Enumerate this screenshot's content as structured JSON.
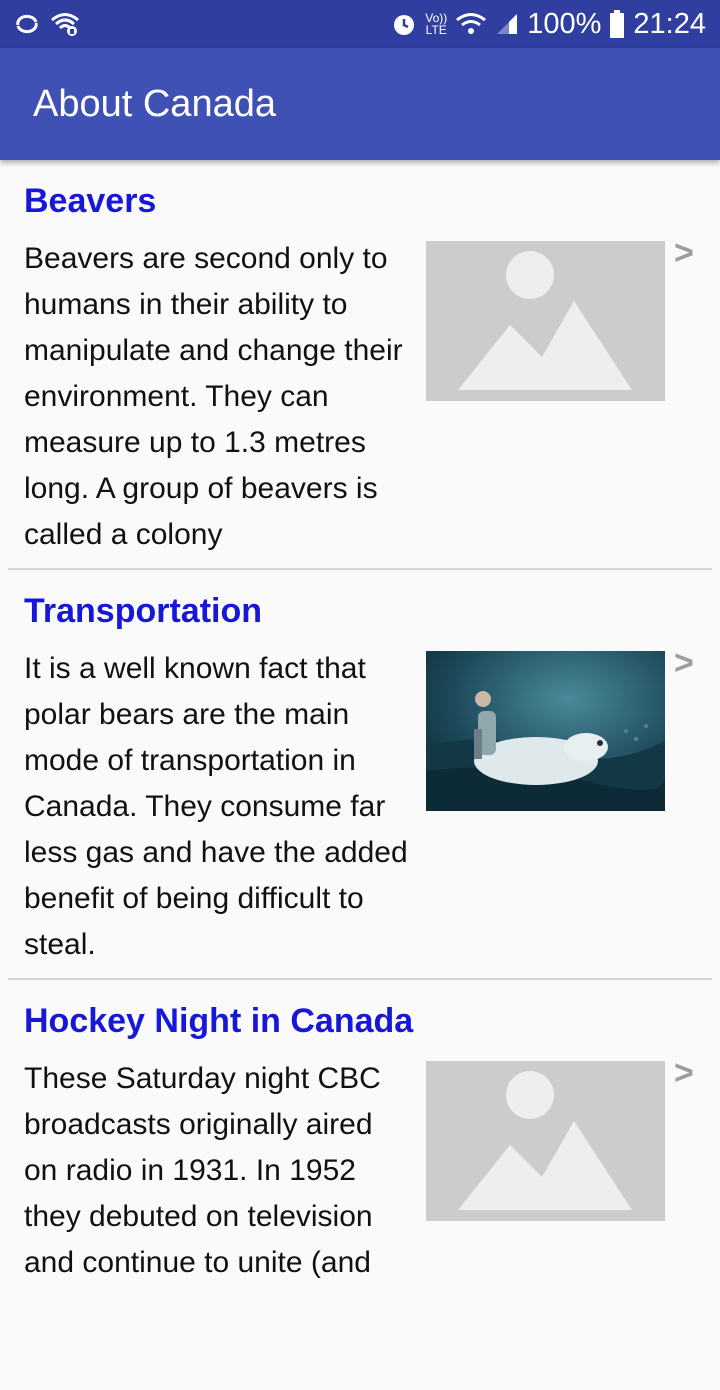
{
  "status_bar": {
    "battery": "100%",
    "time": "21:24",
    "network": "LTE",
    "icons": [
      "sync-icon",
      "wifi-secure-icon",
      "alarm-icon",
      "volte-icon",
      "wifi-icon",
      "signal-icon",
      "battery-icon"
    ]
  },
  "app_bar": {
    "title": "About Canada"
  },
  "items": [
    {
      "title": "Beavers",
      "body": "Beavers are second only to humans in their ability to manipulate and change their environment. They can measure up to 1.3 metres long. A group of beavers is called a colony",
      "image": "placeholder-image",
      "chevron": ">"
    },
    {
      "title": "Transportation",
      "body": "It is a well known fact that polar bears are the main mode of transportation in Canada. They consume far less gas and have the added benefit of being difficult to steal.",
      "image": "polar-bear-rider-photo",
      "chevron": ">"
    },
    {
      "title": "Hockey Night in Canada",
      "body": "These Saturday night CBC broadcasts originally aired on radio in 1931. In 1952 they debuted on television and continue to unite (and",
      "image": "placeholder-image",
      "chevron": ">"
    }
  ]
}
